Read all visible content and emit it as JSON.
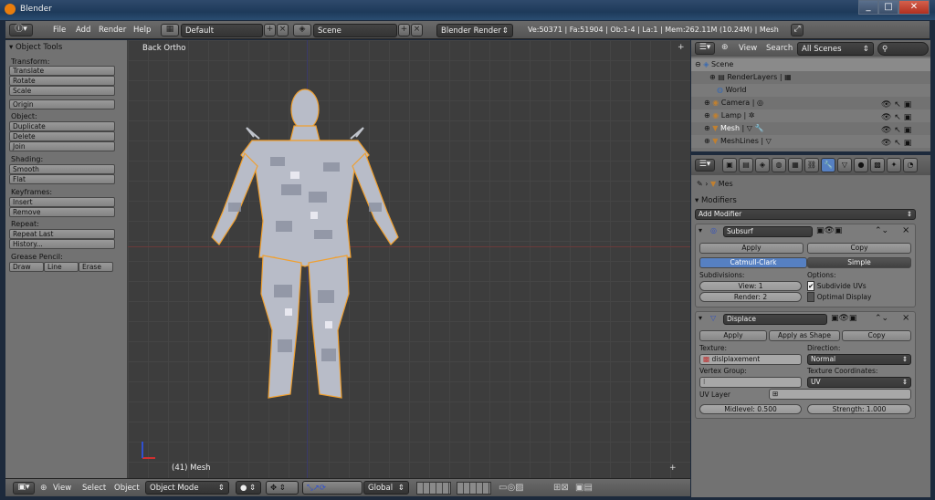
{
  "window": {
    "title": "Blender"
  },
  "infobar": {
    "menus": [
      "File",
      "Add",
      "Render",
      "Help"
    ],
    "screen_layout": "Default",
    "scene": "Scene",
    "engine": "Blender Render",
    "stats": "Ve:50371 | Fa:51904 | Ob:1-4 | La:1 | Mem:262.11M (10.24M) | Mesh"
  },
  "toolshelf": {
    "title": "Object Tools",
    "transform_label": "Transform:",
    "translate": "Translate",
    "rotate": "Rotate",
    "scale": "Scale",
    "origin": "Origin",
    "object_label": "Object:",
    "duplicate": "Duplicate",
    "delete": "Delete",
    "join": "Join",
    "shading_label": "Shading:",
    "smooth": "Smooth",
    "flat": "Flat",
    "keyframes_label": "Keyframes:",
    "insert": "Insert",
    "remove": "Remove",
    "repeat_label": "Repeat:",
    "repeat_last": "Repeat Last",
    "history": "History...",
    "grease_label": "Grease Pencil:",
    "draw": "Draw",
    "line": "Line",
    "erase": "Erase"
  },
  "viewport": {
    "view_name": "Back Ortho",
    "object_info": "(41) Mesh"
  },
  "bottombar": {
    "view": "View",
    "select": "Select",
    "object": "Object",
    "mode": "Object Mode",
    "orientation": "Global"
  },
  "outliner": {
    "view": "View",
    "search": "Search",
    "filter": "All Scenes",
    "items": [
      "Scene",
      "RenderLayers",
      "World",
      "Camera",
      "Lamp",
      "Mesh",
      "MeshLines"
    ]
  },
  "properties": {
    "breadcrumb": "Mes",
    "modifiers_title": "Modifiers",
    "add_modifier": "Add Modifier",
    "subsurf": {
      "name": "Subsurf",
      "apply": "Apply",
      "copy": "Copy",
      "catmull": "Catmull-Clark",
      "simple": "Simple",
      "subdivisions_label": "Subdivisions:",
      "options_label": "Options:",
      "view": "View: 1",
      "render": "Render: 2",
      "subdivide_uvs": "Subdivide UVs",
      "optimal_display": "Optimal Display"
    },
    "displace": {
      "name": "Displace",
      "apply": "Apply",
      "apply_shape": "Apply as Shape",
      "copy": "Copy",
      "texture_label": "Texture:",
      "texture": "dislplaxement",
      "direction_label": "Direction:",
      "direction": "Normal",
      "vgroup_label": "Vertex Group:",
      "texcoords_label": "Texture Coordinates:",
      "texcoords": "UV",
      "uvlayer_label": "UV Layer",
      "midlevel": "Midlevel: 0.500",
      "strength": "Strength: 1.000"
    }
  },
  "colors": {
    "accent": "#5680c2",
    "selection_outline": "#f0a030"
  }
}
